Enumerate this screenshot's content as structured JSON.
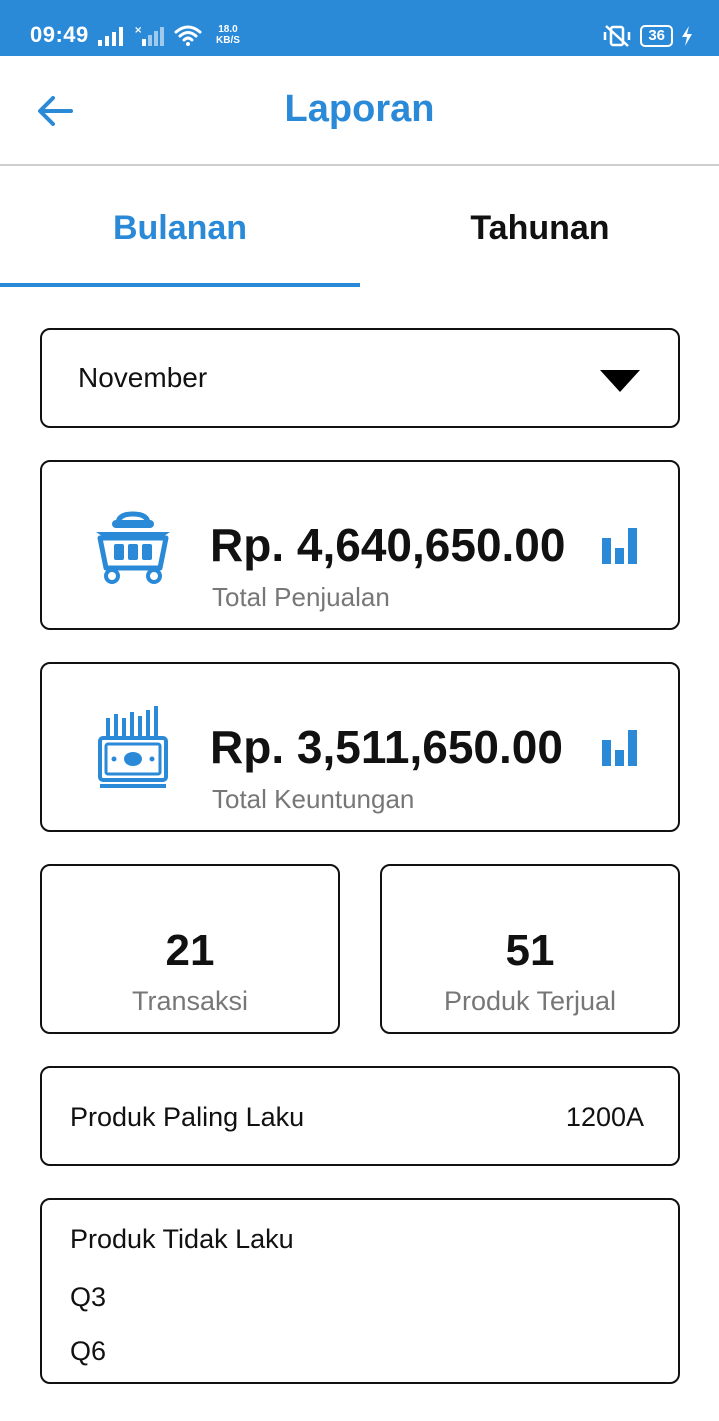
{
  "status_bar": {
    "time": "09:49",
    "network_speed_value": "18.0",
    "network_speed_unit": "KB/S",
    "battery": "36",
    "icons": [
      "signal-icon",
      "no-signal-icon",
      "wifi-icon",
      "vibrate-off-icon",
      "battery-icon",
      "charging-icon"
    ]
  },
  "header": {
    "title": "Laporan",
    "back_icon": "arrow-left-icon"
  },
  "tabs": [
    {
      "label": "Bulanan",
      "active": true
    },
    {
      "label": "Tahunan",
      "active": false
    }
  ],
  "month_select": {
    "selected": "November"
  },
  "summary": {
    "sales": {
      "value": "Rp. 4,640,650.00",
      "label": "Total Penjualan",
      "icon": "shopping-basket-icon"
    },
    "profit": {
      "value": "Rp. 3,511,650.00",
      "label": "Total Keuntungan",
      "icon": "money-chart-icon"
    }
  },
  "stats": {
    "transactions": {
      "value": "21",
      "label": "Transaksi"
    },
    "products_sold": {
      "value": "51",
      "label": "Produk Terjual"
    }
  },
  "best_selling": {
    "label": "Produk Paling Laku",
    "value": "1200A"
  },
  "not_selling": {
    "title": "Produk Tidak Laku",
    "items": [
      "Q3",
      "Q6"
    ]
  },
  "colors": {
    "accent": "#2a8ad8",
    "text": "#111111",
    "muted": "#777777"
  }
}
